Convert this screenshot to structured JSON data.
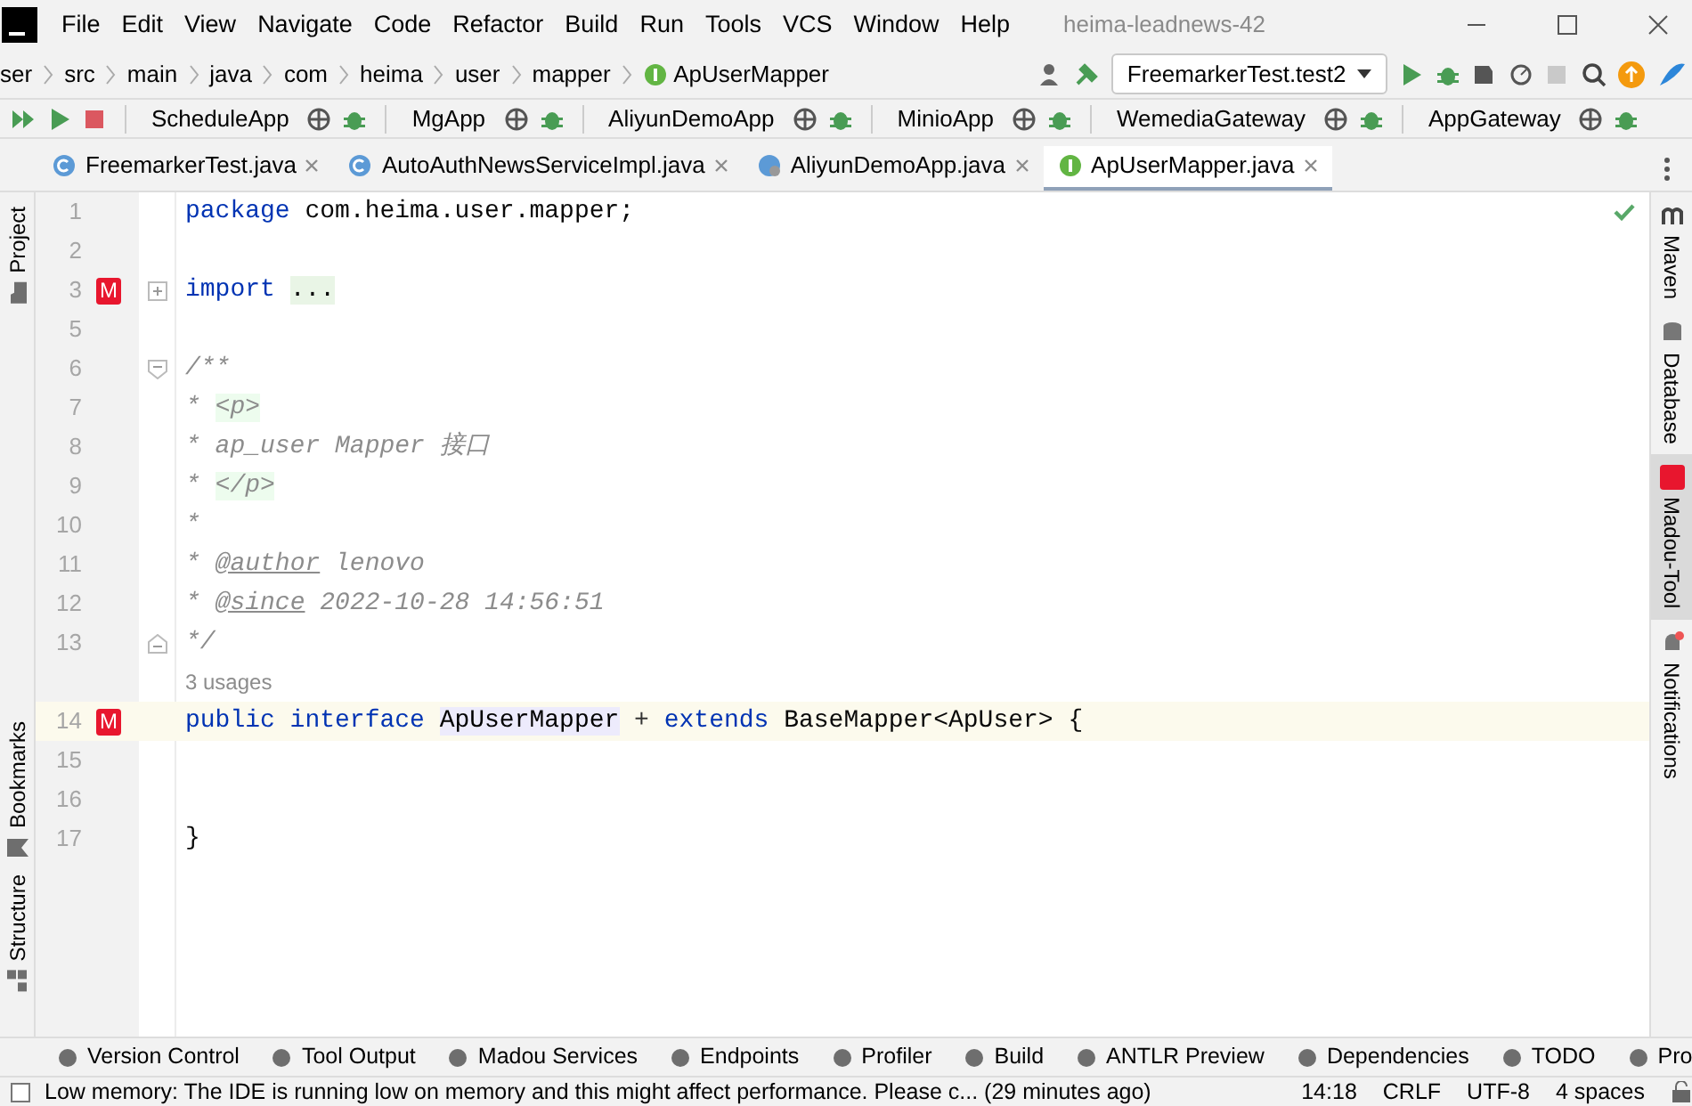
{
  "window": {
    "title": "heima-leadnews-42",
    "menu": [
      "File",
      "Edit",
      "View",
      "Navigate",
      "Code",
      "Refactor",
      "Build",
      "Run",
      "Tools",
      "VCS",
      "Window",
      "Help"
    ]
  },
  "breadcrumb": [
    "ser",
    "src",
    "main",
    "java",
    "com",
    "heima",
    "user",
    "mapper",
    "ApUserMapper"
  ],
  "run_config": "FreemarkerTest.test2",
  "services": [
    "ScheduleApp",
    "MgApp",
    "AliyunDemoApp",
    "MinioApp",
    "WemediaGateway",
    "AppGateway"
  ],
  "tabs": [
    {
      "label": "FreemarkerTest.java",
      "selected": false,
      "kind": "class"
    },
    {
      "label": "AutoAuthNewsServiceImpl.java",
      "selected": false,
      "kind": "class"
    },
    {
      "label": "AliyunDemoApp.java",
      "selected": false,
      "kind": "app"
    },
    {
      "label": "ApUserMapper.java",
      "selected": true,
      "kind": "interface"
    }
  ],
  "editor": {
    "lines": [
      {
        "kind": "code",
        "number": "1",
        "tokens": [
          {
            "text": "package",
            "kind": "keyword"
          },
          {
            "text": " com.heima.user.mapper;",
            "kind": "plain"
          }
        ]
      },
      {
        "kind": "code",
        "number": "2"
      },
      {
        "kind": "code",
        "number": "3",
        "marker": "M",
        "collapsed": true,
        "tokens": [
          {
            "text": "import ",
            "kind": "keyword"
          },
          {
            "text": "...",
            "kind": "folded"
          }
        ]
      },
      {
        "kind": "code",
        "number": "5"
      },
      {
        "kind": "code",
        "number": "6",
        "fold_start": true,
        "tokens": [
          {
            "text": "/**",
            "kind": "comment"
          }
        ]
      },
      {
        "kind": "code",
        "number": "7",
        "tokens": [
          {
            "text": "* ",
            "kind": "comment"
          },
          {
            "text": "<p>",
            "kind": "tag"
          }
        ]
      },
      {
        "kind": "code",
        "number": "8",
        "tokens": [
          {
            "text": "* ap_user Mapper 接口",
            "kind": "comment"
          }
        ]
      },
      {
        "kind": "code",
        "number": "9",
        "tokens": [
          {
            "text": "* ",
            "kind": "comment"
          },
          {
            "text": "</p>",
            "kind": "tag"
          }
        ]
      },
      {
        "kind": "code",
        "number": "10",
        "tokens": [
          {
            "text": "*",
            "kind": "comment"
          }
        ]
      },
      {
        "kind": "code",
        "number": "11",
        "tokens": [
          {
            "text": "* ",
            "kind": "comment"
          },
          {
            "text": "@author",
            "kind": "doctag"
          },
          {
            "text": " lenovo",
            "kind": "comment"
          }
        ]
      },
      {
        "kind": "code",
        "number": "12",
        "tokens": [
          {
            "text": "* ",
            "kind": "comment"
          },
          {
            "text": "@since",
            "kind": "doctag"
          },
          {
            "text": " 2022-10-28 14:56:51",
            "kind": "comment"
          }
        ]
      },
      {
        "kind": "code",
        "number": "13",
        "fold_end": true,
        "tokens": [
          {
            "text": "*/",
            "kind": "comment"
          }
        ]
      },
      {
        "kind": "hint",
        "text": "3 usages"
      },
      {
        "kind": "code",
        "number": "14",
        "marker": "M",
        "current": true,
        "tokens": [
          {
            "text": "public interface ",
            "kind": "keyword"
          },
          {
            "text": "ApUserMapper",
            "kind": "highlight"
          },
          {
            "text": " + ",
            "kind": "plus"
          },
          {
            "text": "extends",
            "kind": "keyword"
          },
          {
            "text": " BaseMapper<ApUser> {",
            "kind": "plain"
          }
        ]
      },
      {
        "kind": "code",
        "number": "15"
      },
      {
        "kind": "code",
        "number": "16"
      },
      {
        "kind": "code",
        "number": "17",
        "tokens": [
          {
            "text": "}",
            "kind": "plain"
          }
        ]
      }
    ]
  },
  "left_tools": [
    {
      "label": "Project"
    },
    {
      "label": "Bookmarks"
    },
    {
      "label": "Structure"
    }
  ],
  "right_tools": [
    {
      "label": "Maven",
      "selected": false
    },
    {
      "label": "Database",
      "selected": false
    },
    {
      "label": "Madou-Tool",
      "selected": true
    },
    {
      "label": "Notifications",
      "selected": false
    }
  ],
  "bottom_tools": [
    "Version Control",
    "Tool Output",
    "Madou Services",
    "Endpoints",
    "Profiler",
    "Build",
    "ANTLR Preview",
    "Dependencies",
    "TODO",
    "Pro"
  ],
  "status_bar": {
    "message": "Low memory: The IDE is running low on memory and this might affect performance. Please c... (29 minutes ago)",
    "items": [
      "14:18",
      "CRLF",
      "UTF-8",
      "4 spaces"
    ]
  }
}
